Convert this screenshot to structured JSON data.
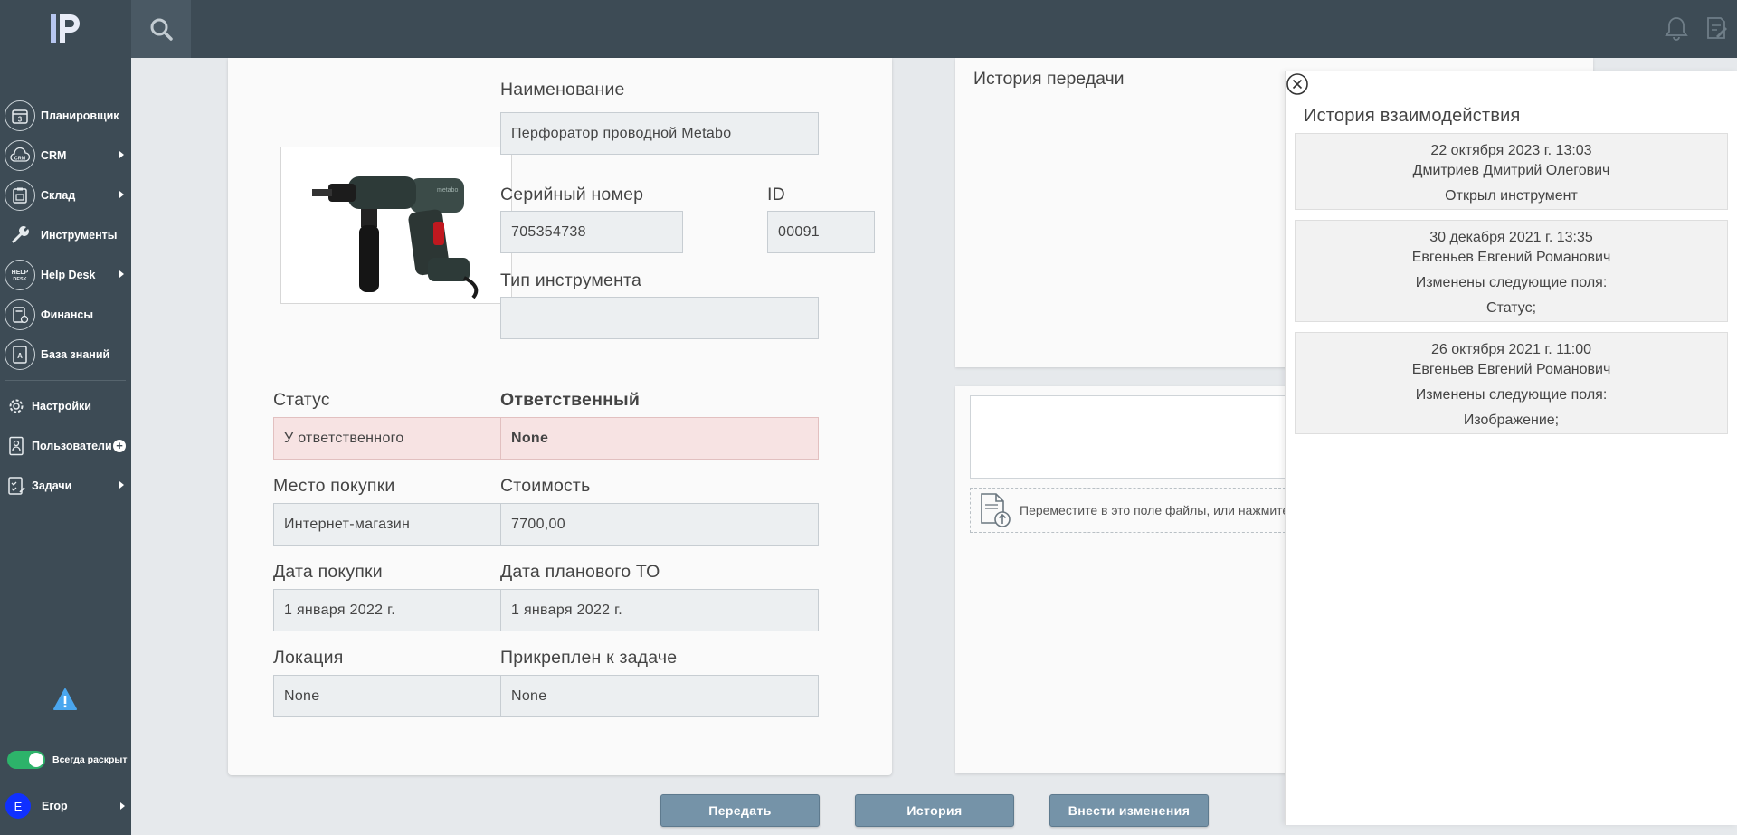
{
  "sidebar": {
    "logo": "IP",
    "items": [
      {
        "label": "Планировщик",
        "icon": "calendar-icon",
        "glyph": "3",
        "arrow": false
      },
      {
        "label": "CRM",
        "icon": "crm-cloud-icon",
        "glyph": "CRM",
        "arrow": true
      },
      {
        "label": "Склад",
        "icon": "warehouse-icon",
        "glyph": "▤",
        "arrow": true
      },
      {
        "label": "Инструменты",
        "icon": "wrench-icon",
        "glyph": "🔧",
        "arrow": false
      },
      {
        "label": "Help Desk",
        "icon": "helpdesk-icon",
        "glyph": "HELP DESK",
        "arrow": true
      },
      {
        "label": "Финансы",
        "icon": "finance-icon",
        "glyph": "₽",
        "arrow": false
      },
      {
        "label": "База знаний",
        "icon": "knowledge-base-icon",
        "glyph": "A",
        "arrow": false
      }
    ],
    "settings": "Настройки",
    "users": "Пользователи",
    "tasks": "Задачи",
    "toggle_label": "Всегда раскрыт",
    "user_initial": "Е",
    "user_name": "Егор"
  },
  "item": {
    "name_label": "Наименование",
    "name_value": "Перфоратор проводной Metabo",
    "serial_label": "Серийный номер",
    "serial_value": "705354738",
    "id_label": "ID",
    "id_value": "00091",
    "type_label": "Тип инструмента",
    "type_value": "",
    "status_label": "Статус",
    "status_value": "У ответственного",
    "responsible_label": "Ответственный",
    "responsible_value": "None",
    "purchase_place_label": "Место покупки",
    "purchase_place_value": "Интернет-магазин",
    "cost_label": "Стоимость",
    "cost_value": "7700,00",
    "purchase_date_label": "Дата покупки",
    "purchase_date_value": "1 января 2022 г.",
    "maintenance_label": "Дата планового ТО",
    "maintenance_value": "1 января 2022 г.",
    "location_label": "Локация",
    "location_value": "None",
    "attached_label": "Прикреплен к задаче",
    "attached_value": "None"
  },
  "transfer_history": {
    "title": "История передачи"
  },
  "upload": {
    "dropzone_text": "Переместите в это поле файлы, или нажмите"
  },
  "interaction_history": {
    "title": "История взаимодействия",
    "entries": [
      {
        "date": "22 октября 2023 г. 13:03",
        "user": "Дмитриев Дмитрий Олегович",
        "action": "Открыл инструмент",
        "detail": ""
      },
      {
        "date": "30 декабря 2021 г. 13:35",
        "user": "Евгеньев Евгений Романович",
        "action": "Изменены следующие поля:",
        "detail": "Статус;"
      },
      {
        "date": "26 октября 2021 г. 11:00",
        "user": "Евгеньев Евгений Романович",
        "action": "Изменены следующие поля:",
        "detail": "Изображение;"
      }
    ]
  },
  "actions": {
    "transfer": "Передать",
    "history": "История",
    "edit": "Внести изменения"
  }
}
